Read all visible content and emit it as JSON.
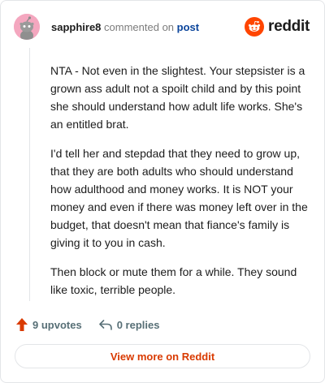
{
  "header": {
    "username": "sapphire8",
    "commented_text": "commented on",
    "post_link": "post",
    "brand_word": "reddit"
  },
  "comment": {
    "paragraphs": [
      "NTA - Not even in the slightest. Your stepsister is a grown ass adult not a spoilt child and by this point she should understand how adult life works. She's an entitled brat.",
      "I'd tell her and stepdad that they need to grow up, that they are both adults who should understand how adulthood and money works. It is NOT your money and even if there was money left over in the budget, that doesn't mean that fiance's family is giving it to you in cash.",
      "Then block or mute them for a while. They sound like toxic, terrible people."
    ]
  },
  "actions": {
    "upvotes_label": "9 upvotes",
    "replies_label": "0 replies"
  },
  "footer": {
    "view_more_label": "View more on Reddit"
  },
  "colors": {
    "brand_orange": "#ff4500",
    "upvote_orange": "#d93a00",
    "post_link_blue": "#0a449b",
    "avatar_pink": "#f4a7bf"
  },
  "icons": {
    "avatar": "snoo-avatar",
    "brand": "reddit-snoo-logo",
    "upvote": "upvote-arrow-icon",
    "reply": "reply-arrow-icon"
  }
}
